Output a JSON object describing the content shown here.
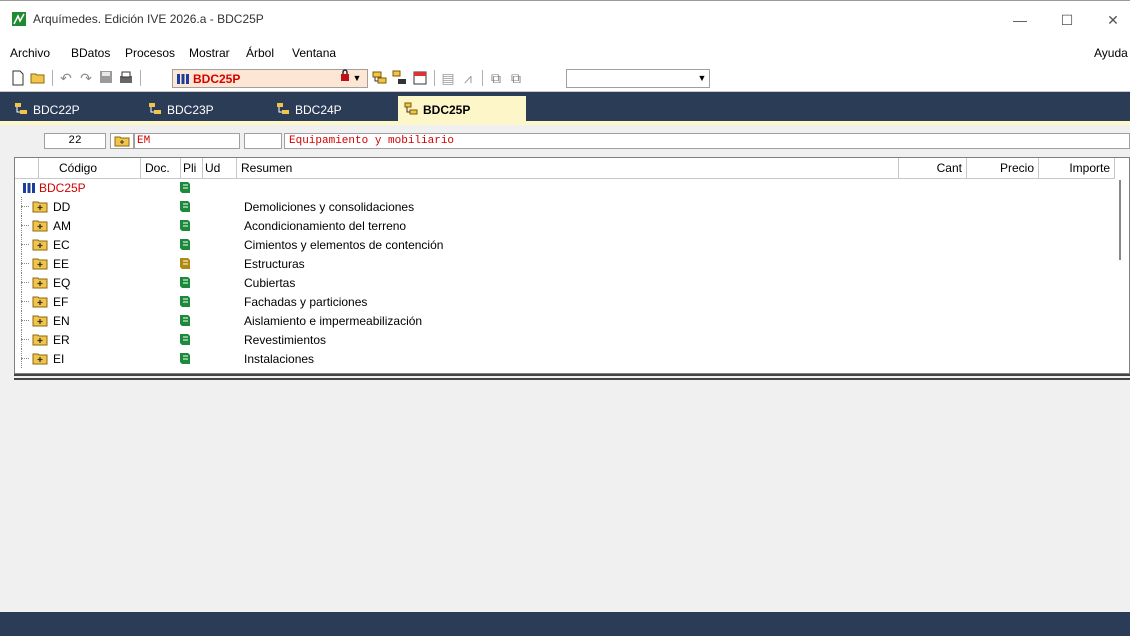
{
  "window": {
    "title": "Arquímedes. Edición IVE 2026.a - BDC25P",
    "minimize": "—",
    "maximize": "☐",
    "close": "✕"
  },
  "menu": {
    "items": [
      "Archivo",
      "BDatos",
      "Procesos",
      "Mostrar",
      "Árbol",
      "Ventana"
    ],
    "help": "Ayuda"
  },
  "toolbar": {
    "database": "BDC25P"
  },
  "tabs": [
    {
      "label": "BDC22P",
      "active": false
    },
    {
      "label": "BDC23P",
      "active": false
    },
    {
      "label": "BDC24P",
      "active": false
    },
    {
      "label": "BDC25P",
      "active": true
    }
  ],
  "pathbar": {
    "count": "22",
    "code": "EM",
    "unit": "",
    "summary": "Equipamiento y mobiliario"
  },
  "columns": {
    "codigo": "Código",
    "doc": "Doc.",
    "pli": "Pli",
    "ud": "Ud",
    "resumen": "Resumen",
    "cant": "Cant",
    "precio": "Precio",
    "importe": "Importe"
  },
  "root": {
    "code": "BDC25P"
  },
  "rows": [
    {
      "code": "DD",
      "summary": "Demoliciones y consolidaciones"
    },
    {
      "code": "AM",
      "summary": "Acondicionamiento del terreno"
    },
    {
      "code": "EC",
      "summary": "Cimientos y elementos de contención"
    },
    {
      "code": "EE",
      "summary": "Estructuras"
    },
    {
      "code": "EQ",
      "summary": "Cubiertas"
    },
    {
      "code": "EF",
      "summary": "Fachadas y particiones"
    },
    {
      "code": "EN",
      "summary": "Aislamiento e impermeabilización"
    },
    {
      "code": "ER",
      "summary": "Revestimientos"
    },
    {
      "code": "EI",
      "summary": "Instalaciones"
    }
  ],
  "colors": {
    "tabbar": "#2b3c57",
    "activeTab": "#fdf6c8",
    "dbCode": "#d40000",
    "pliIcon": "#1c8a3a"
  }
}
